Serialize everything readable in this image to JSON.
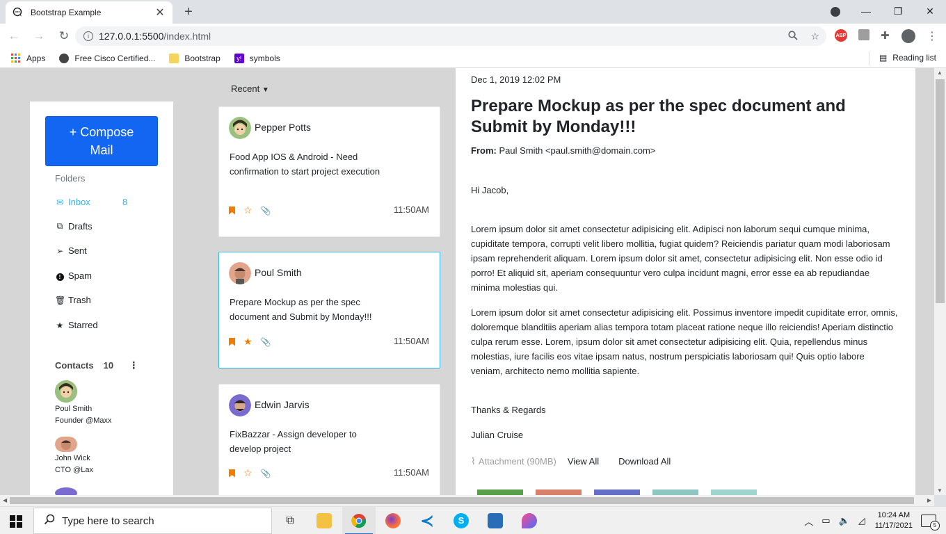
{
  "browser": {
    "tab_title": "Bootstrap Example",
    "url_host": "127.0.0.1:5500",
    "url_path": "/index.html",
    "bookmarks": [
      "Apps",
      "Free Cisco Certified...",
      "Bootstrap",
      "symbols"
    ],
    "reading_list": "Reading list",
    "abp_label": "ABP"
  },
  "sidebar": {
    "compose_line1": "+ Compose",
    "compose_line2": "Mail",
    "folders_label": "Folders",
    "folders": [
      {
        "label": "Inbox",
        "count": "8",
        "icon": "envelope-icon"
      },
      {
        "label": "Drafts",
        "icon": "copy-icon"
      },
      {
        "label": "Sent",
        "icon": "send-icon"
      },
      {
        "label": "Spam",
        "icon": "exclamation-icon"
      },
      {
        "label": "Trash",
        "icon": "trash-icon"
      },
      {
        "label": "Starred",
        "icon": "star-icon"
      }
    ],
    "contacts_label": "Contacts",
    "contacts_count": "10",
    "contacts": [
      {
        "name": "Poul Smith",
        "title": "Founder @Maxx"
      },
      {
        "name": "John Wick",
        "title": "CTO @Lax"
      }
    ]
  },
  "list": {
    "sort_label": "Recent",
    "items": [
      {
        "name": "Pepper Potts",
        "subject": "Food App IOS & Android - Need confirmation to start project execution",
        "time": "11:50AM",
        "starred": false
      },
      {
        "name": "Poul Smith",
        "subject": "Prepare Mockup as per the spec document and Submit by Monday!!!",
        "time": "11:50AM",
        "starred": true
      },
      {
        "name": "Edwin Jarvis",
        "subject": "FixBazzar - Assign developer to develop project",
        "time": "11:50AM",
        "starred": false
      }
    ]
  },
  "reader": {
    "date": "Dec 1, 2019 12:02 PM",
    "subject": "Prepare Mockup as per the spec document and Submit by Monday!!!",
    "from_label": "From:",
    "from_value": "Paul Smith <paul.smith@domain.com>",
    "greeting": "Hi Jacob,",
    "para1": "Lorem ipsum dolor sit amet consectetur adipisicing elit. Adipisci non laborum sequi cumque minima, cupiditate tempora, corrupti velit libero mollitia, fugiat quidem? Reiciendis pariatur quam modi laboriosam ipsam reprehenderit aliquam. Lorem ipsum dolor sit amet, consectetur adipisicing elit. Non esse odio id porro! Et aliquid sit, aperiam consequuntur vero culpa incidunt magni, error esse ea ab repudiandae minima molestias qui.",
    "para2": "Lorem ipsum dolor sit amet consectetur adipisicing elit. Possimus inventore impedit cupiditate error, omnis, doloremque blanditiis aperiam alias tempora totam placeat ratione neque illo reiciendis! Aperiam distinctio culpa rerum esse. Lorem, ipsum dolor sit amet consectetur adipisicing elit. Quia, repellendus minus molestias, iure facilis eos vitae ipsam natus, nostrum perspiciatis laboriosam qui! Quis optio labore veniam, architecto nemo mollitia sapiente.",
    "signoff": "Thanks & Regards",
    "signature": "Julian Cruise",
    "attachment_label": "Attachment (90MB)",
    "view_all": "View All",
    "download_all": "Download All"
  },
  "taskbar": {
    "search_placeholder": "Type here to search",
    "time": "10:24 AM",
    "date": "11/17/2021",
    "notification_count": "5"
  },
  "colors": {
    "primary": "#1266f1",
    "accent_blue": "#2fb5e8",
    "accent_orange": "#f27c00"
  }
}
